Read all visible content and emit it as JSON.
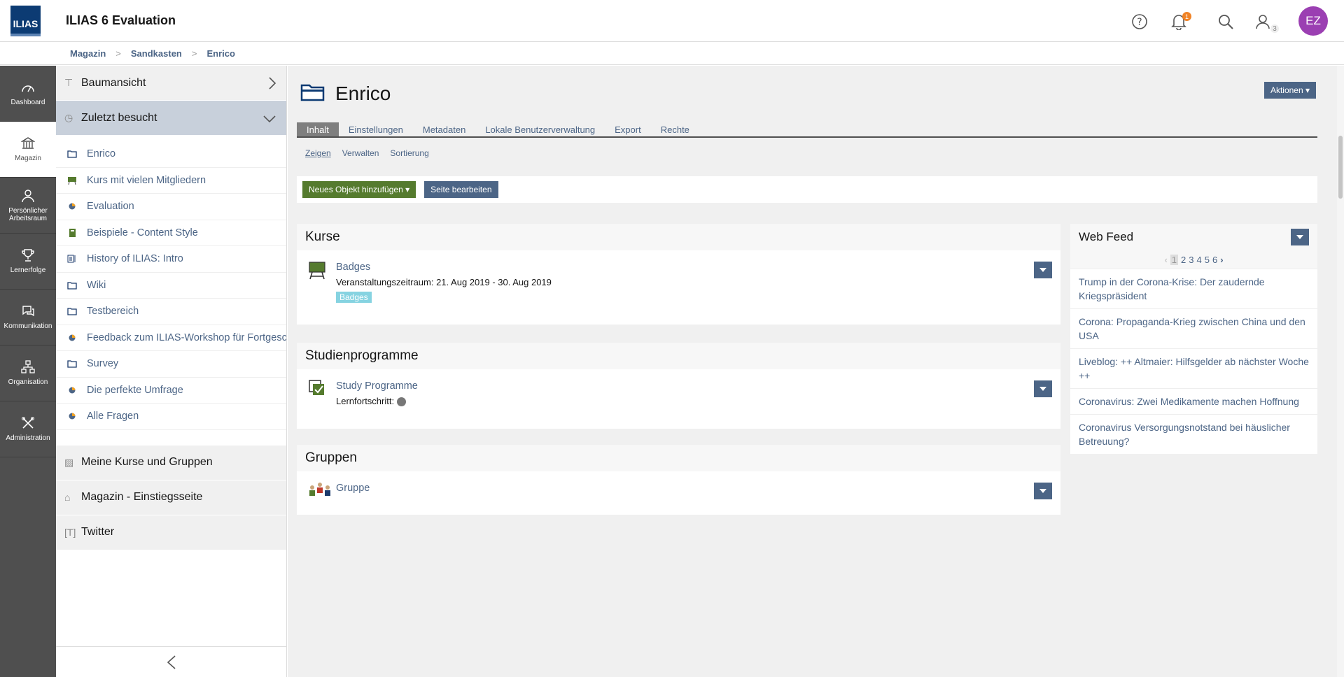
{
  "header": {
    "logo": "ILIAS",
    "title": "ILIAS 6 Evaluation",
    "notification_count": "1",
    "contacts_count": "3",
    "avatar": "EZ"
  },
  "breadcrumb": [
    "Magazin",
    "Sandkasten",
    "Enrico"
  ],
  "mainbar": [
    "Dashboard",
    "Magazin",
    "Persönlicher Arbeitsraum",
    "Lernerfolge",
    "Kommunikation",
    "Organisation",
    "Administration"
  ],
  "slate": {
    "tree_view": "Baumansicht",
    "recent": "Zuletzt besucht",
    "recent_items": [
      "Enrico",
      "Kurs mit vielen Mitgliedern",
      "Evaluation",
      "Beispiele - Content Style",
      "History of ILIAS: Intro",
      "Wiki",
      "Testbereich",
      "Feedback zum ILIAS-Workshop für Fortgeschrittene",
      "Survey",
      "Die perfekte Umfrage",
      "Alle Fragen"
    ],
    "my_courses": "Meine Kurse und Gruppen",
    "repo_home": "Magazin - Einstiegsseite",
    "twitter": "Twitter"
  },
  "content": {
    "title": "Enrico",
    "actions": "Aktionen",
    "tabs": [
      "Inhalt",
      "Einstellungen",
      "Metadaten",
      "Lokale Benutzerverwaltung",
      "Export",
      "Rechte"
    ],
    "subtabs": [
      "Zeigen",
      "Verwalten",
      "Sortierung"
    ],
    "add_object": "Neues Objekt hinzufügen",
    "edit_page": "Seite bearbeiten",
    "courses": {
      "heading": "Kurse",
      "item": "Badges",
      "period": "Veranstaltungszeitraum: 21. Aug 2019 - 30. Aug 2019",
      "tag": "Badges"
    },
    "programmes": {
      "heading": "Studienprogramme",
      "item": "Study Programme",
      "progress": "Lernfortschritt:"
    },
    "groups": {
      "heading": "Gruppen",
      "item": "Gruppe"
    }
  },
  "webfeed": {
    "title": "Web Feed",
    "pages": [
      "1",
      "2",
      "3",
      "4",
      "5",
      "6"
    ],
    "items": [
      "Trump in der Corona-Krise: Der zaudernde Kriegspräsident",
      "Corona: Propaganda-Krieg zwischen China und den USA",
      "Liveblog: ++ Altmaier: Hilfsgelder ab nächster Woche ++",
      "Coronavirus: Zwei Medikamente machen Hoffnung",
      "Coronavirus Versorgungsnotstand bei häuslicher Betreuung?"
    ]
  },
  "colors": {
    "accent": "#4c6586",
    "green": "#557b2e",
    "mainbar": "#4f4f4f",
    "avatar": "#9b3fb2"
  }
}
